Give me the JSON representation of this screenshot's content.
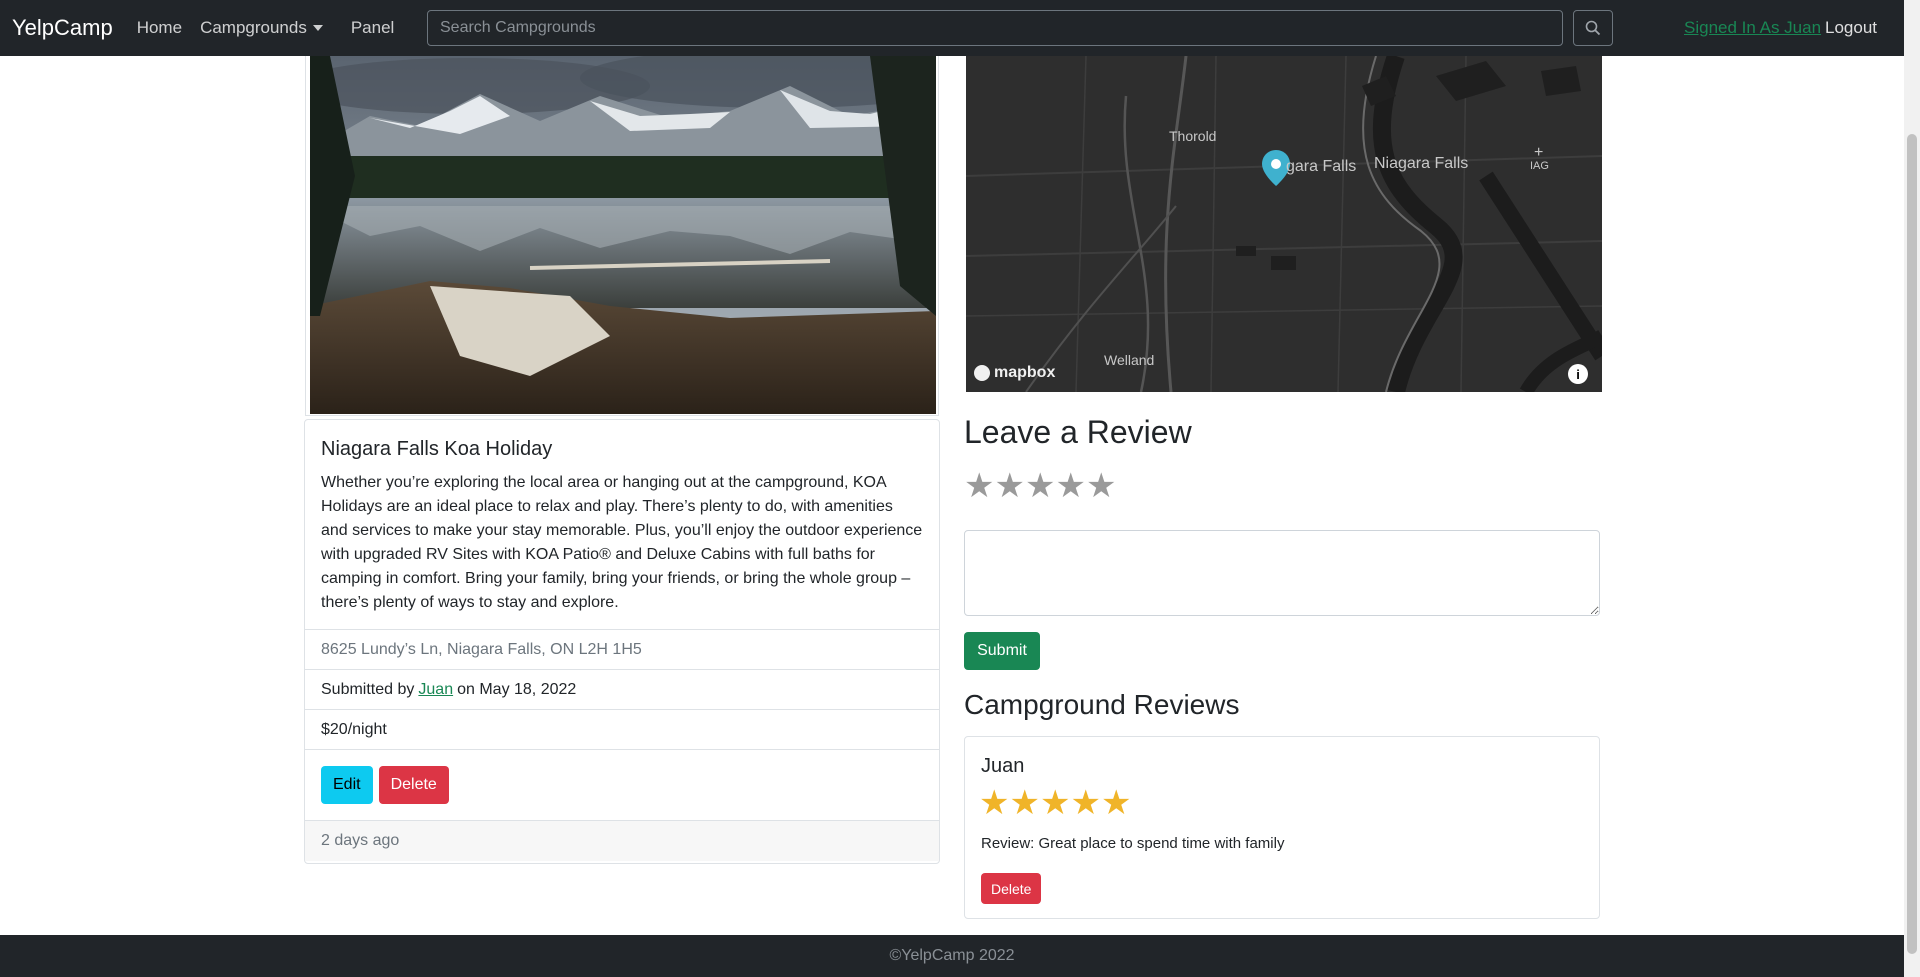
{
  "navbar": {
    "brand": "YelpCamp",
    "home": "Home",
    "campgrounds": "Campgrounds",
    "panel": "Panel",
    "search_placeholder": "Search Campgrounds",
    "signed_in": "Signed In As Juan",
    "logout": "Logout"
  },
  "campground": {
    "title": "Niagara Falls Koa Holiday",
    "description": "Whether you’re exploring the local area or hanging out at the campground, KOA Holidays are an ideal place to relax and play. There’s plenty to do, with amenities and services to make your stay memorable. Plus, you’ll enjoy the outdoor experience with upgraded RV Sites with KOA Patio® and Deluxe Cabins with full baths for camping in comfort. Bring your family, bring your friends, or bring the whole group – there’s plenty of ways to stay and explore.",
    "location": "8625 Lundy’s Ln, Niagara Falls, ON L2H 1H5",
    "submitted_prefix": "Submitted by",
    "author": "Juan",
    "submitted_suffix": "on May 18, 2022",
    "price": "$20/night",
    "edit_label": "Edit",
    "delete_label": "Delete",
    "posted": "2 days ago"
  },
  "map": {
    "labels": {
      "thorold": "Thorold",
      "niagara_falls_marker": "gara Falls",
      "niagara_falls": "Niagara Falls",
      "iag": "IAG",
      "welland": "Welland"
    },
    "attribution": "mapbox",
    "info": "i"
  },
  "review_form": {
    "heading": "Leave a Review",
    "rating": 0,
    "submit_label": "Submit"
  },
  "reviews": {
    "heading": "Campground Reviews",
    "items": [
      {
        "author": "Juan",
        "rating": 5,
        "text": "Review: Great place to spend time with family",
        "delete_label": "Delete"
      }
    ]
  },
  "footer": {
    "text": "©YelpCamp 2022"
  },
  "colors": {
    "navbar_bg": "#212529",
    "success": "#198754",
    "info": "#0dcaf0",
    "danger": "#dc3545",
    "star_gold": "#f0b429",
    "star_empty": "#9a9a9a"
  }
}
